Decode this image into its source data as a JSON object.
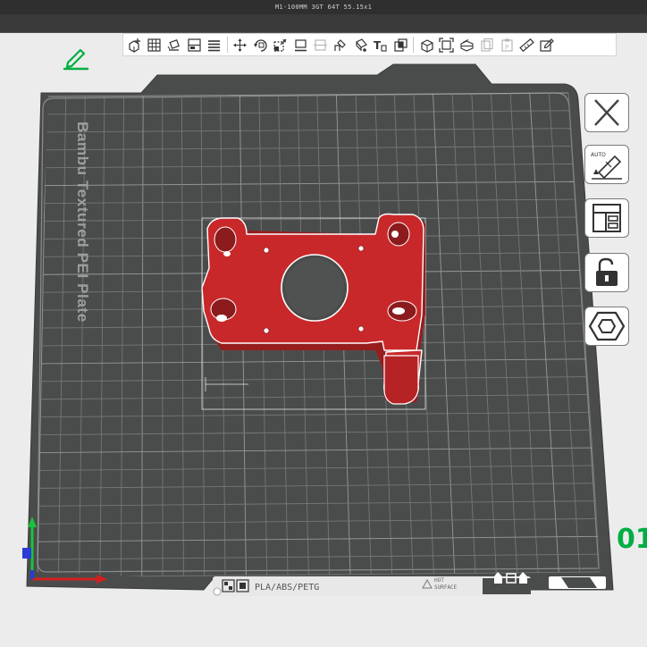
{
  "window": {
    "title": "M1-100MM 3GT 64T 55.15x1"
  },
  "toolbar": {
    "buttons": [
      {
        "name": "add-icon"
      },
      {
        "name": "arrange-grid-icon"
      },
      {
        "name": "orient-icon"
      },
      {
        "name": "split-objects-icon"
      },
      {
        "name": "layers-icon"
      },
      {
        "name": "move-icon"
      },
      {
        "name": "rotate-icon"
      },
      {
        "name": "scale-icon"
      },
      {
        "name": "lay-on-face-icon"
      },
      {
        "name": "cut-icon",
        "disabled": true
      },
      {
        "name": "support-paint-icon"
      },
      {
        "name": "seam-paint-icon"
      },
      {
        "name": "text-shape-icon"
      },
      {
        "name": "mesh-boolean-icon"
      },
      {
        "name": "cube-view-icon"
      },
      {
        "name": "fit-view-icon"
      },
      {
        "name": "assembly-icon"
      },
      {
        "name": "copy-icon",
        "disabled": true
      },
      {
        "name": "paste-icon",
        "disabled": true
      },
      {
        "name": "measure-icon"
      },
      {
        "name": "settings-icon"
      }
    ]
  },
  "plate": {
    "name_label": "Bambu Textured PEI Plate",
    "filament_label": "PLA/ABS/PETG",
    "surface_label_line1": "HOT",
    "surface_label_line2": "SURFACE"
  },
  "side_tools": {
    "auto_label": "AUTO"
  },
  "plater": {
    "index_label": "01"
  },
  "colors": {
    "accent": "#00ae42",
    "plate": "#4a4c4c",
    "model": "#c8282a"
  }
}
